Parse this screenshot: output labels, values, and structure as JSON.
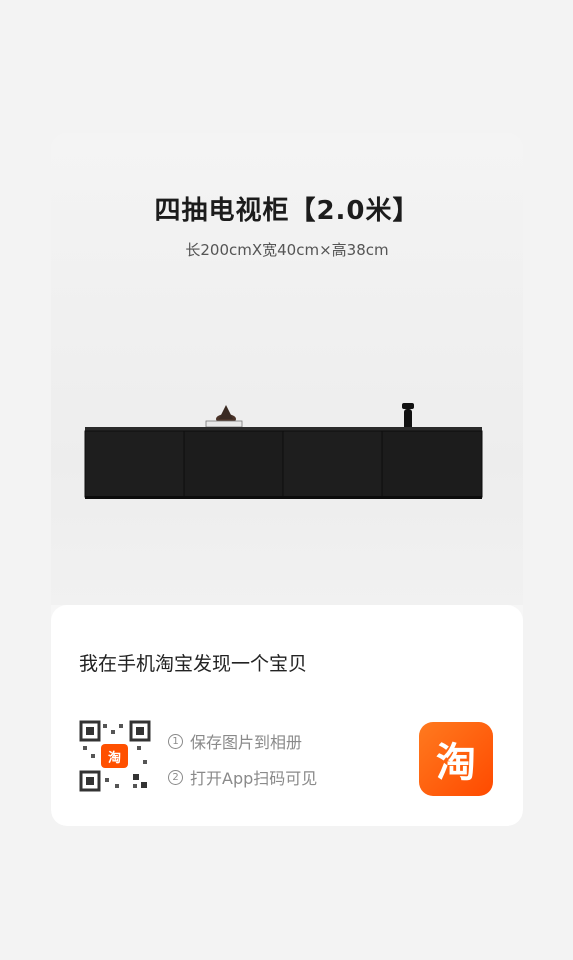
{
  "product": {
    "title": "四抽电视柜【2.0米】",
    "spec": "长200cmX宽40cm×高38cm"
  },
  "share": {
    "text": "我在手机淘宝发现一个宝贝",
    "qr_badge": "淘",
    "step1_num": "1",
    "step1": "保存图片到相册",
    "step2_num": "2",
    "step2": "打开App扫码可见",
    "logo_glyph": "淘"
  },
  "colors": {
    "brand": "#ff5000",
    "cabinet": "#1a1a1a"
  }
}
